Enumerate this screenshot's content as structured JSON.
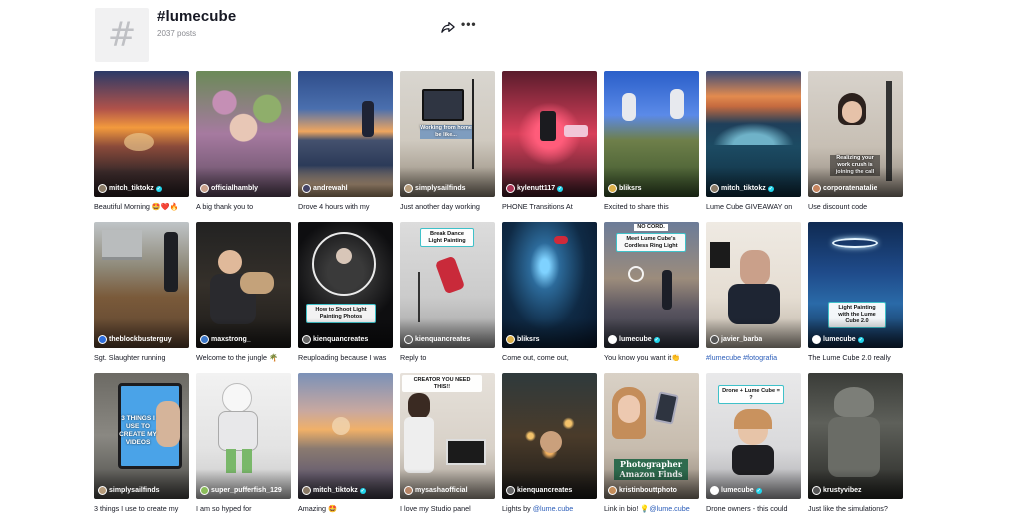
{
  "header": {
    "title": "#lumecube",
    "posts": "2037 posts",
    "hash_glyph": "#",
    "more_glyph": "•••"
  },
  "colors": {
    "verified": "#20d5ec",
    "hashtag_link": "#2b5db9",
    "avatar_placeholder": "#f1f1f2"
  },
  "videos": [
    {
      "author": "mitch_tiktokz",
      "verified": true,
      "caption": "Beautiful Morning 🤩❤️🔥"
    },
    {
      "author": "officialhambly",
      "verified": false,
      "caption": "A big thank you to"
    },
    {
      "author": "andrewahl",
      "verified": false,
      "caption": "Drove 4 hours with my"
    },
    {
      "author": "simplysailfinds",
      "verified": false,
      "caption": "Just another day working",
      "overlay_text": "Working from home be like..."
    },
    {
      "author": "kylenutt117",
      "verified": true,
      "caption": "PHONE Transitions At"
    },
    {
      "author": "bliksrs",
      "verified": false,
      "caption": "Excited to share this"
    },
    {
      "author": "mitch_tiktokz",
      "verified": true,
      "caption": "Lume Cube GIVEAWAY on"
    },
    {
      "author": "corporatenatalie",
      "verified": false,
      "caption": "Use discount code",
      "overlay_text": "Realizing your work crush is joining the call"
    },
    {
      "author": "theblockbusterguy",
      "verified": false,
      "caption": "Sgt. Slaughter running"
    },
    {
      "author": "maxstrong_",
      "verified": false,
      "caption": "Welcome to the jungle 🌴"
    },
    {
      "author": "kienquancreates",
      "verified": false,
      "caption": "Reuploading because I was",
      "overlay_text": "How to Shoot Light Painting Photos"
    },
    {
      "author": "kienquancreates",
      "verified": false,
      "caption": "Reply to",
      "overlay_text": "Break Dance Light Painting"
    },
    {
      "author": "bliksrs",
      "verified": false,
      "caption": "Come out, come out,"
    },
    {
      "author": "lumecube",
      "verified": true,
      "caption": "You know you want it👏",
      "overlay_text": "Meet Lume Cube's Cordless Ring Light",
      "top_text": "NO CORD."
    },
    {
      "author": "javier_barba",
      "verified": false,
      "caption": "#lumecube #fotografia",
      "caption_is_tag": true
    },
    {
      "author": "lumecube",
      "verified": true,
      "caption": "The Lume Cube 2.0 really",
      "overlay_text": "Light Painting with the Lume Cube 2.0"
    },
    {
      "author": "simplysailfinds",
      "verified": false,
      "caption": "3 things I use to create my",
      "overlay_text": "3 THINGS I USE TO CREATE MY VIDEOS"
    },
    {
      "author": "super_pufferfish_129",
      "verified": false,
      "caption": "I am so hyped for"
    },
    {
      "author": "mitch_tiktokz",
      "verified": true,
      "caption": "Amazing 🤩"
    },
    {
      "author": "mysashaofficial",
      "verified": false,
      "caption": "I love my Studio panel",
      "overlay_text": "CREATOR YOU NEED THIS!!"
    },
    {
      "author": "kienquancreates",
      "verified": false,
      "caption": "Lights by @lume.cube",
      "caption_tag": "@lume.cube"
    },
    {
      "author": "kristinbouttphoto",
      "verified": false,
      "caption": "Link in bio! 💡@lume.cube",
      "caption_tag": "@lume.cube",
      "overlay_text": "Photographer Amazon Finds"
    },
    {
      "author": "lumecube",
      "verified": true,
      "caption": "Drone owners - this could",
      "overlay_text": "Drone + Lume Cube = ?"
    },
    {
      "author": "krustyvibez",
      "verified": false,
      "caption": "Just like the simulations?"
    }
  ]
}
